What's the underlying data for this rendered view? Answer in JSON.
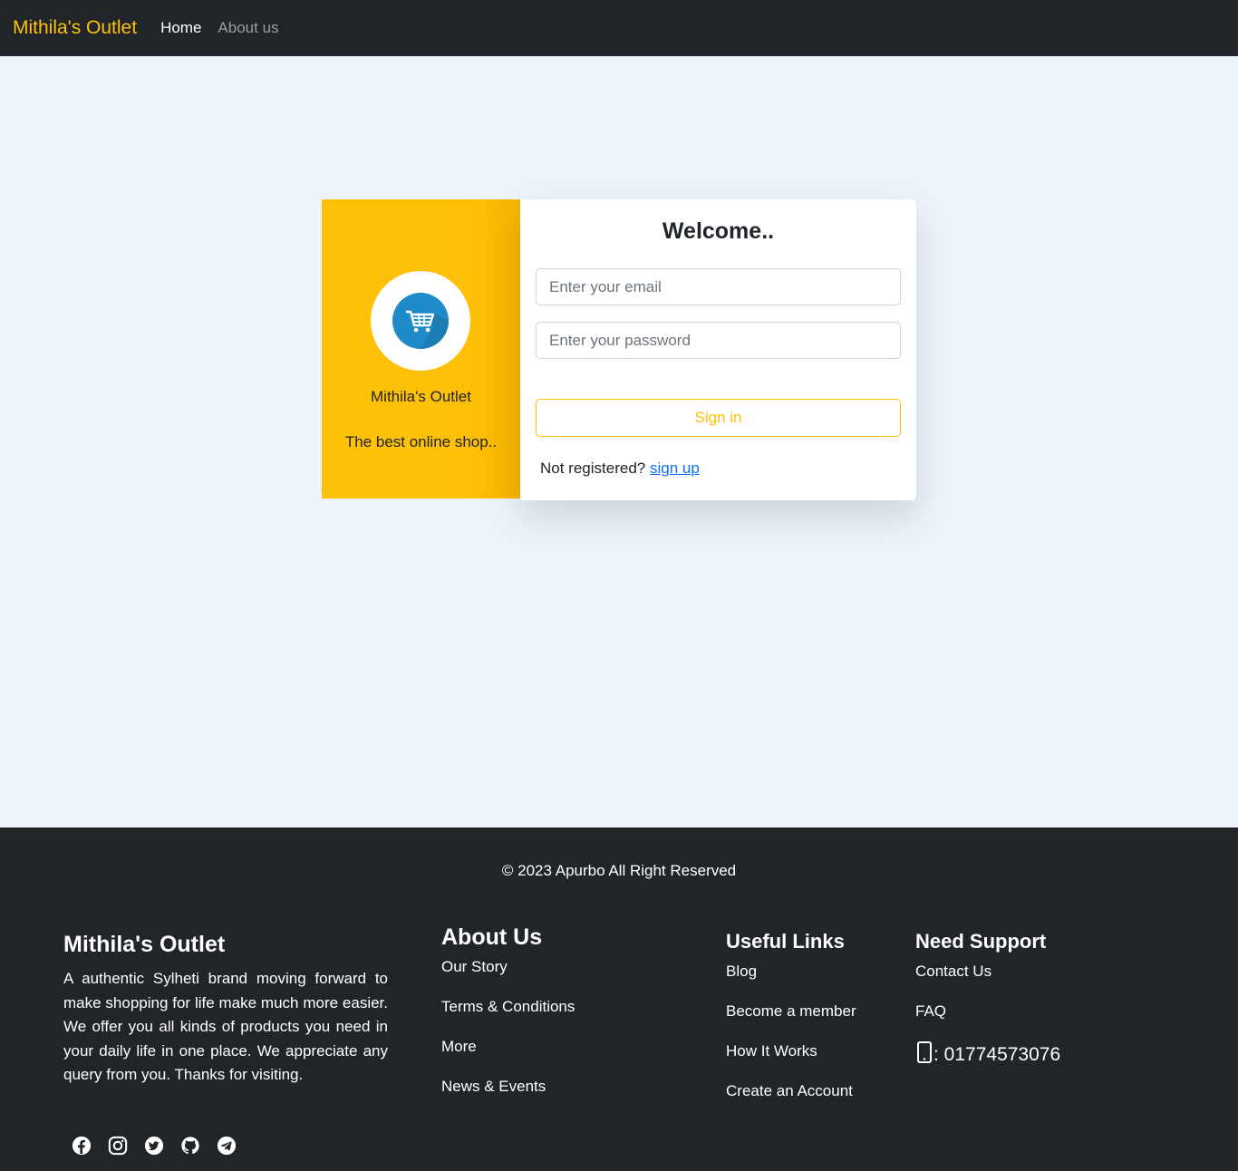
{
  "navbar": {
    "brand": "Mithila's Outlet",
    "links": [
      {
        "label": "Home"
      },
      {
        "label": "About us"
      }
    ]
  },
  "brand_panel": {
    "logo_icon": "shopping-cart-icon",
    "title": "Mithila's Outlet",
    "subtitle": "The best online shop.."
  },
  "login": {
    "heading": "Welcome..",
    "email_placeholder": "Enter your email",
    "password_placeholder": "Enter your password",
    "signin_label": "Sign in",
    "not_registered": "Not registered?",
    "signup_label": "sign up"
  },
  "footer": {
    "copyright": "© 2023 Apurbo All Right Reserved",
    "brand": {
      "title": "Mithila's Outlet",
      "description": "A authentic Sylheti brand moving forward to make shopping for life make much more easier. We offer you all kinds of products you need in your daily life in one place. We appreciate any query from you. Thanks for visiting."
    },
    "socials": [
      "facebook-icon",
      "instagram-icon",
      "twitter-icon",
      "github-icon",
      "telegram-icon"
    ],
    "about": {
      "title": "About Us",
      "links": [
        "Our Story",
        "Terms & Conditions",
        "More",
        "News & Events"
      ]
    },
    "useful": {
      "title": "Useful Links",
      "links": [
        "Blog",
        "Become a member",
        "How It Works",
        "Create an Account"
      ]
    },
    "support": {
      "title": "Need Support",
      "links": [
        "Contact Us",
        "FAQ"
      ],
      "phone": ": 01774573076"
    }
  },
  "colors": {
    "accent": "#ffc107",
    "dark": "#212529",
    "background": "#ecf3fb",
    "link": "#0d6efd"
  }
}
